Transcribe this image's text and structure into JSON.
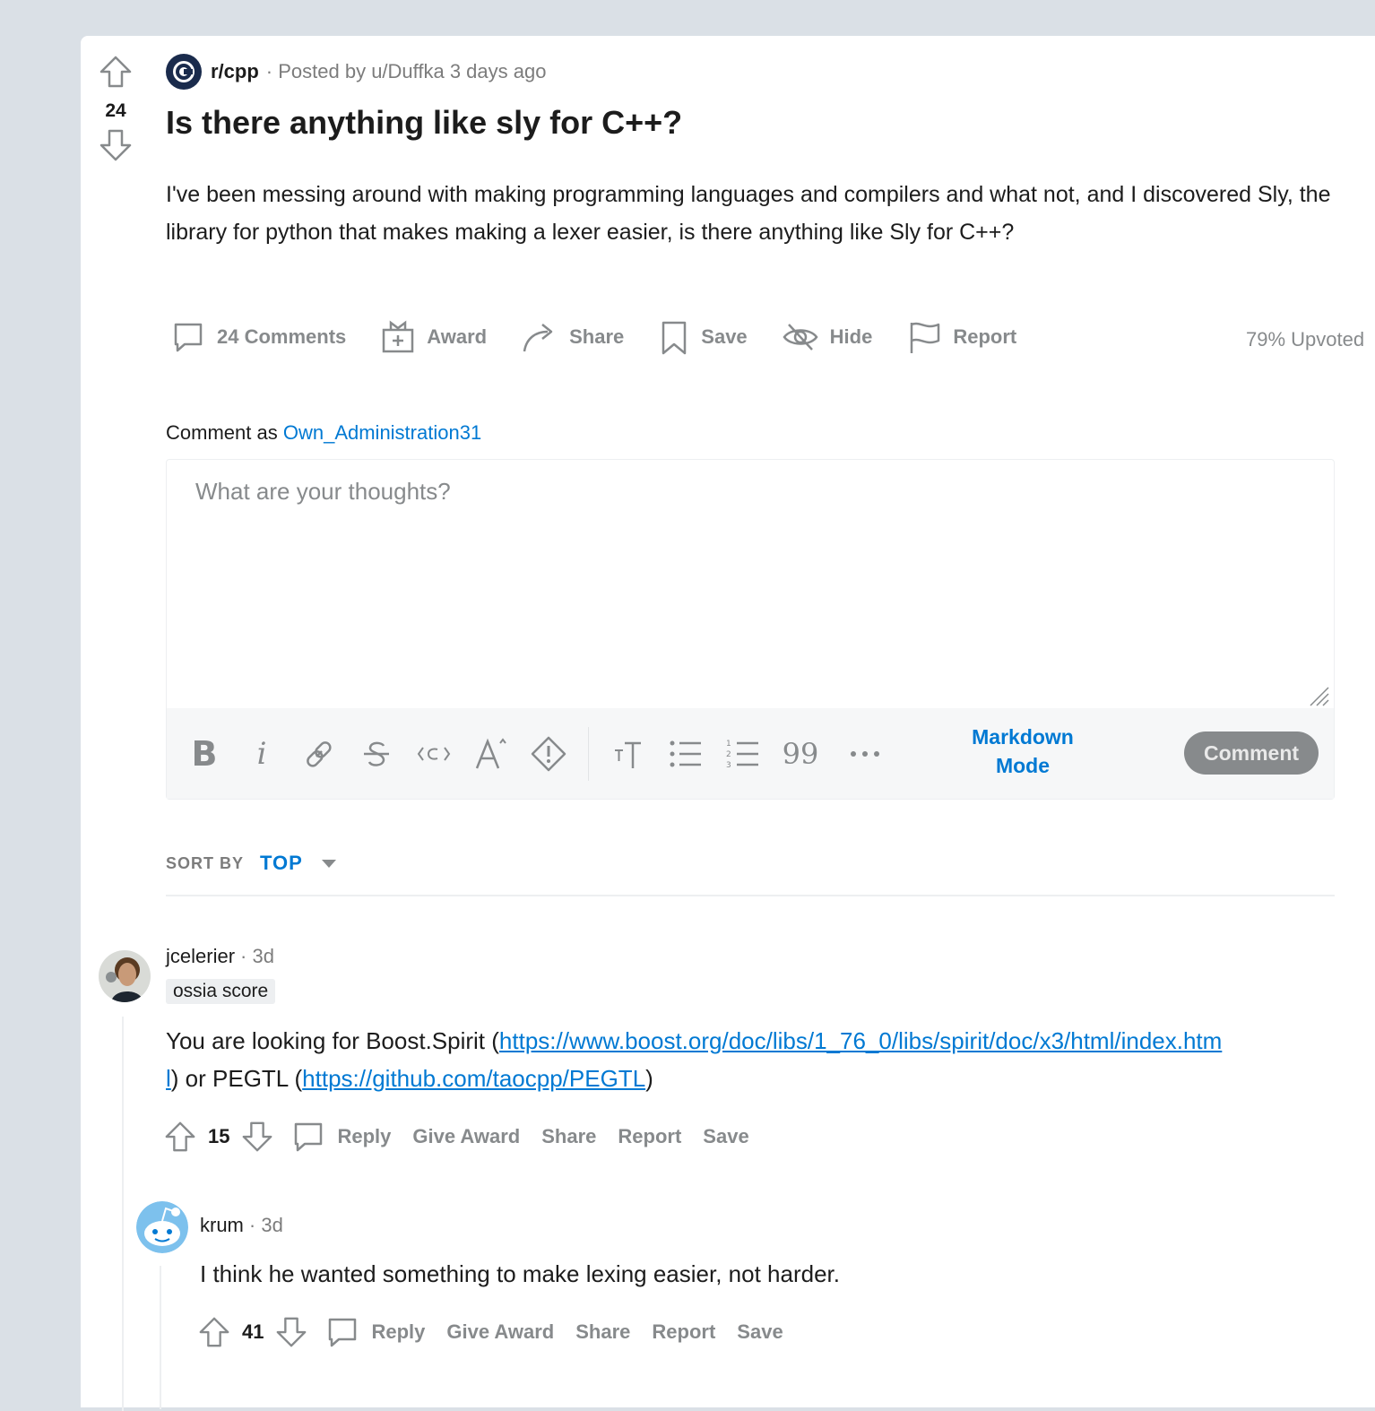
{
  "post": {
    "score": "24",
    "subreddit": "r/cpp",
    "posted_by": "· Posted by u/Duffka 3 days ago",
    "title": "Is there anything like sly for C++?",
    "body": "I've been messing around with making programming languages and compilers and what not, and I discovered Sly, the library for python that makes making a lexer easier, is there anything like Sly for C++?",
    "actions": {
      "comments": "24 Comments",
      "award": "Award",
      "share": "Share",
      "save": "Save",
      "hide": "Hide",
      "report": "Report"
    },
    "upvoted": "79% Upvoted"
  },
  "comment_box": {
    "label": "Comment as",
    "username": "Own_Administration31",
    "placeholder": "What are your thoughts?",
    "markdown_mode": "Markdown Mode",
    "submit": "Comment"
  },
  "sort": {
    "label": "SORT BY",
    "value": "TOP"
  },
  "comments": [
    {
      "author": "jcelerier",
      "time": "· 3d",
      "flair": "ossia score",
      "body_prefix": "You are looking for Boost.Spirit (",
      "link1": "https://www.boost.org/doc/libs/1_76_0/libs/spirit/doc/x3/html/index.html",
      "body_mid": ") or PEGTL (",
      "link2": "https://github.com/taocpp/PEGTL",
      "body_suffix": ")",
      "score": "15",
      "reply": "Reply",
      "give_award": "Give Award",
      "share": "Share",
      "report": "Report",
      "save": "Save"
    },
    {
      "author": "krum",
      "time": "· 3d",
      "body": "I think he wanted something to make lexing easier, not harder.",
      "score": "41",
      "reply": "Reply",
      "give_award": "Give Award",
      "share": "Share",
      "report": "Report",
      "save": "Save"
    }
  ],
  "colors": {
    "background": "#dae0e6",
    "accent": "#0079d3",
    "muted": "#878a8c"
  }
}
